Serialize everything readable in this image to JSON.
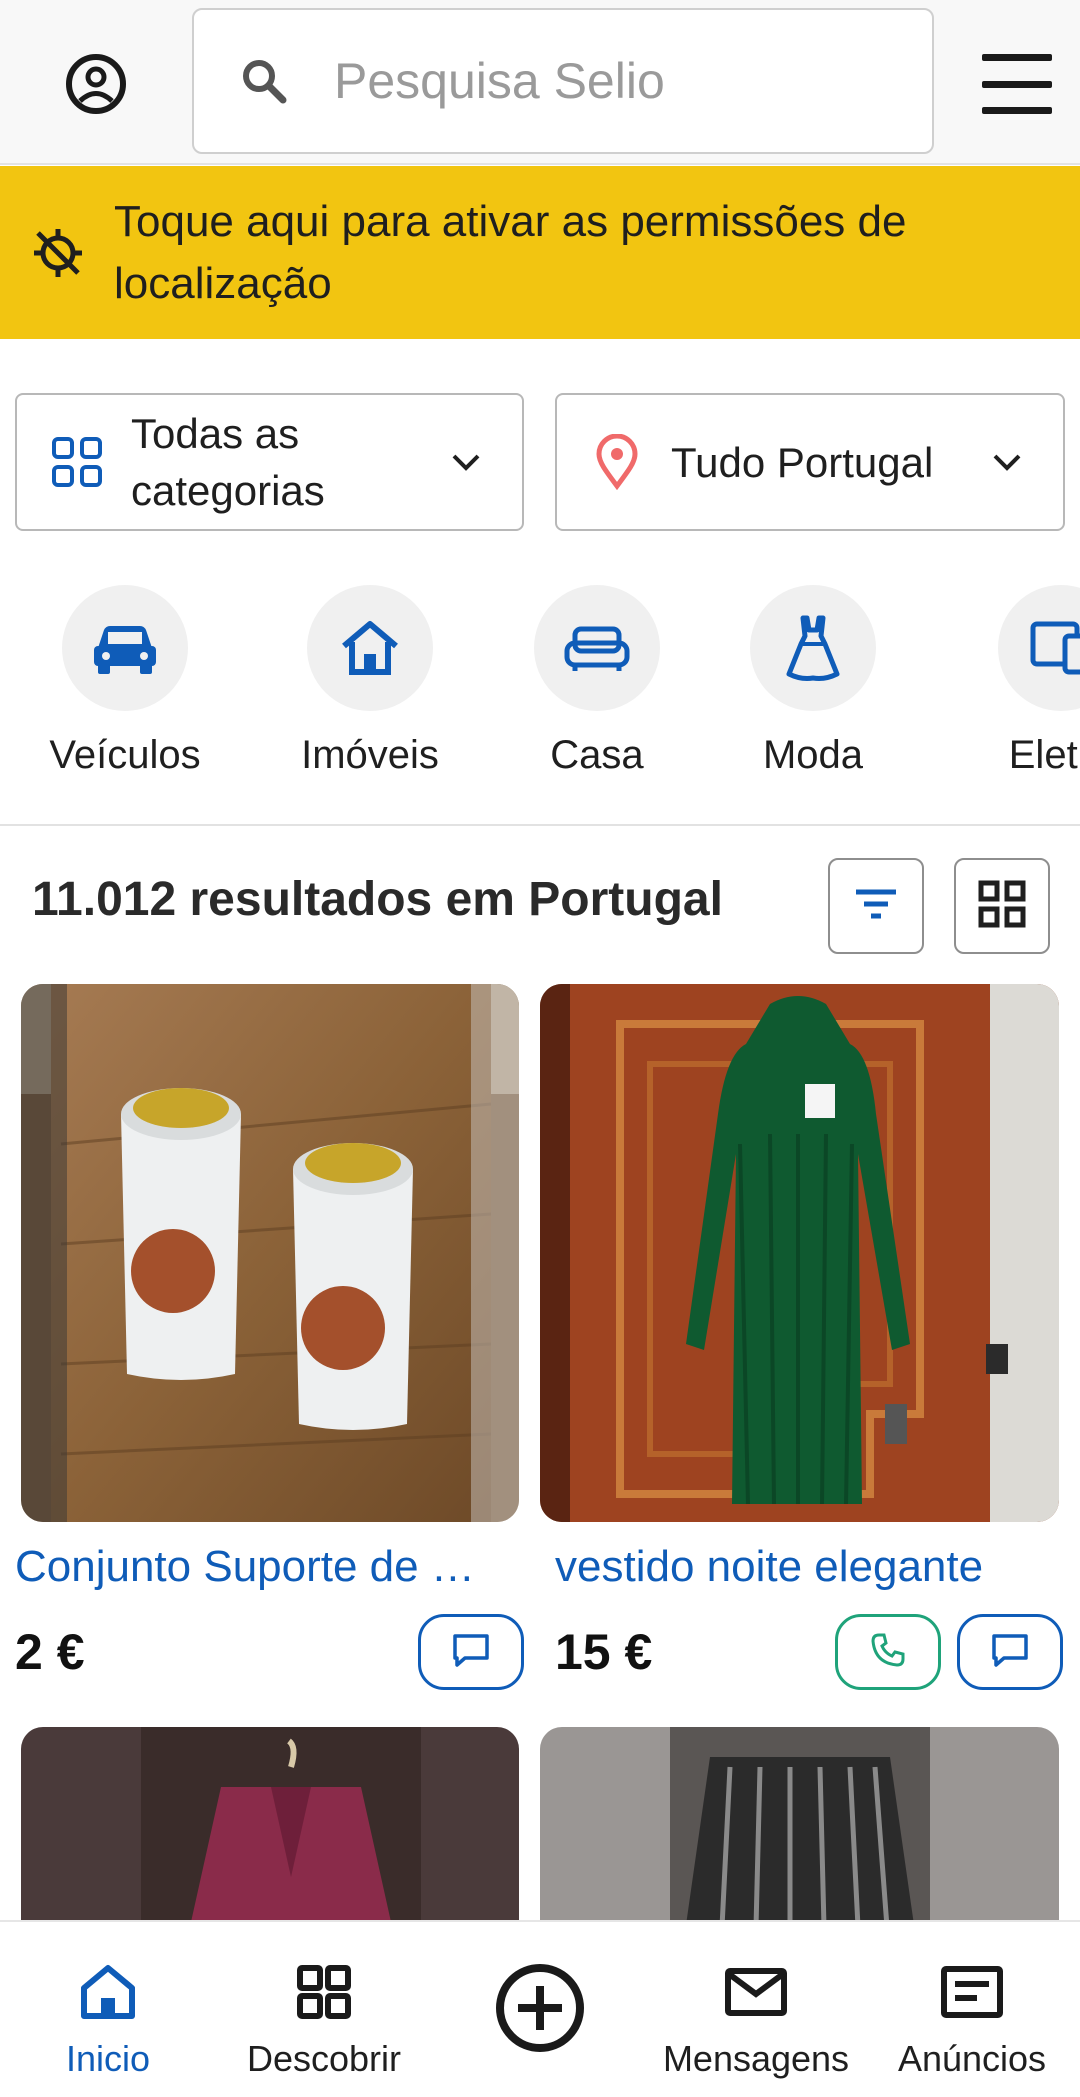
{
  "header": {
    "search_placeholder": "Pesquisa Selio",
    "account_icon": "account-circle-icon",
    "search_icon": "search-icon",
    "menu_icon": "hamburger-menu-icon"
  },
  "banner": {
    "text": "Toque aqui para ativar as permissões de localização",
    "icon": "location-disabled-icon",
    "color": "#f2c511"
  },
  "filters": {
    "category": "Todas as categorias",
    "location": "Tudo Portugal"
  },
  "categories": [
    {
      "label": "Veículos",
      "icon": "car-icon"
    },
    {
      "label": "Imóveis",
      "icon": "house-icon"
    },
    {
      "label": "Casa",
      "icon": "sofa-icon"
    },
    {
      "label": "Moda",
      "icon": "dress-icon"
    },
    {
      "label": "Eletró",
      "icon": "devices-icon"
    }
  ],
  "results": {
    "summary": "11.012 resultados em Portugal"
  },
  "listings": [
    {
      "title": "Conjunto Suporte de …",
      "price": "2 €",
      "actions": [
        "message"
      ]
    },
    {
      "title": "vestido noite elegante",
      "price": "15 €",
      "actions": [
        "call",
        "message"
      ]
    }
  ],
  "bottom_nav": [
    {
      "label": "Inicio",
      "icon": "home-icon",
      "active": true
    },
    {
      "label": "Descobrir",
      "icon": "grid-icon",
      "active": false
    },
    {
      "label": "",
      "icon": "add-circle-icon",
      "active": false
    },
    {
      "label": "Mensagens",
      "icon": "mail-icon",
      "active": false
    },
    {
      "label": "Anúncios",
      "icon": "ads-icon",
      "active": false
    }
  ],
  "colors": {
    "accent": "#0f5cb8",
    "call_green": "#1fa37a",
    "location_pin": "#f06a6a"
  }
}
